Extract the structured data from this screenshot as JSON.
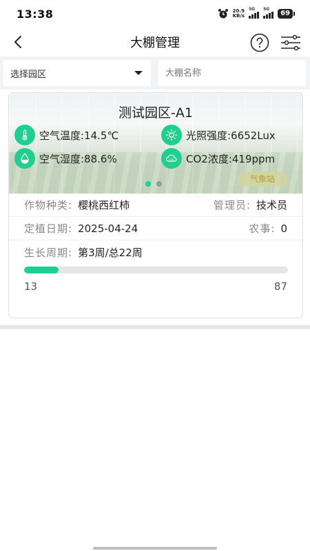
{
  "status_bar": {
    "time": "13:38",
    "net_speed_value": "20.9",
    "net_speed_unit": "KB/s",
    "signal_1": "5G",
    "signal_2": "5G",
    "battery": "69"
  },
  "nav": {
    "title": "大棚管理"
  },
  "filters": {
    "park_select_label": "选择园区",
    "name_placeholder": "大棚名称"
  },
  "card": {
    "title": "测试园区-A1",
    "metrics": {
      "air_temp": "空气温度:14.5℃",
      "light": "光照强度:6652Lux",
      "air_humidity": "空气湿度:88.6%",
      "co2": "CO2浓度:419ppm"
    },
    "weather_station_label": "气象站",
    "carousel": {
      "count": 2,
      "active": 0
    },
    "crop_label": "作物种类:",
    "crop_value": "樱桃西红柿",
    "manager_label": "管理员:",
    "manager_value": "技术员",
    "plant_date_label": "定植日期:",
    "plant_date_value": "2025-04-24",
    "farm_work_label": "农事:",
    "farm_work_value": "0",
    "growth_label": "生长周期:",
    "growth_value": "第3周/总22周",
    "progress_fraction": 0.13,
    "progress_left": "13",
    "progress_right": "87"
  },
  "colors": {
    "accent": "#1ecf8f",
    "background_strip": "#f2f3f5"
  }
}
